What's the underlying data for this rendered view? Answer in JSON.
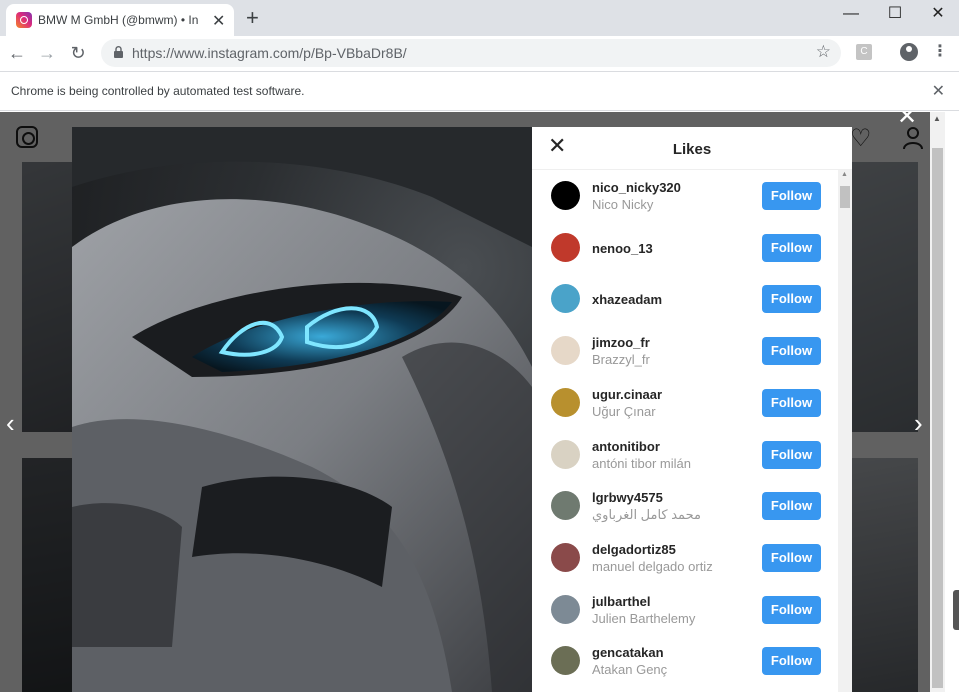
{
  "browser": {
    "tab_title": "BMW M GmbH (@bmwm) • Insta",
    "url_prefix": "https://www.instagram.com",
    "url_path": "/p/Bp-VBbaDr8B/",
    "infobar_text": "Chrome is being controlled by automated test software."
  },
  "likes": {
    "title": "Likes",
    "follow_label": "Follow",
    "users": [
      {
        "username": "nico_nicky320",
        "full_name": "Nico Nicky",
        "avatar_color": "#000000"
      },
      {
        "username": "nenoo_13",
        "full_name": "",
        "avatar_color": "#c0392b"
      },
      {
        "username": "xhazeadam",
        "full_name": "",
        "avatar_color": "#4aa3c9"
      },
      {
        "username": "jimzoo_fr",
        "full_name": "Brazzyl_fr",
        "avatar_color": "#e6d8c8"
      },
      {
        "username": "ugur.cinaar",
        "full_name": "Uğur Çınar",
        "avatar_color": "#b8902e"
      },
      {
        "username": "antonitibor",
        "full_name": "antóni tibor milán",
        "avatar_color": "#d9d2c3"
      },
      {
        "username": "lgrbwy4575",
        "full_name": "محمد كامل الغرباوي",
        "avatar_color": "#6f7a70"
      },
      {
        "username": "delgadortiz85",
        "full_name": "manuel delgado ortiz",
        "avatar_color": "#8a4a4a"
      },
      {
        "username": "julbarthel",
        "full_name": "Julien Barthelemy",
        "avatar_color": "#7d8a95"
      },
      {
        "username": "gencatakan",
        "full_name": "Atakan Genç",
        "avatar_color": "#6b6e55"
      }
    ]
  },
  "colors": {
    "follow_button": "#3897f0",
    "overlay": "rgba(0,0,0,0.62)"
  }
}
